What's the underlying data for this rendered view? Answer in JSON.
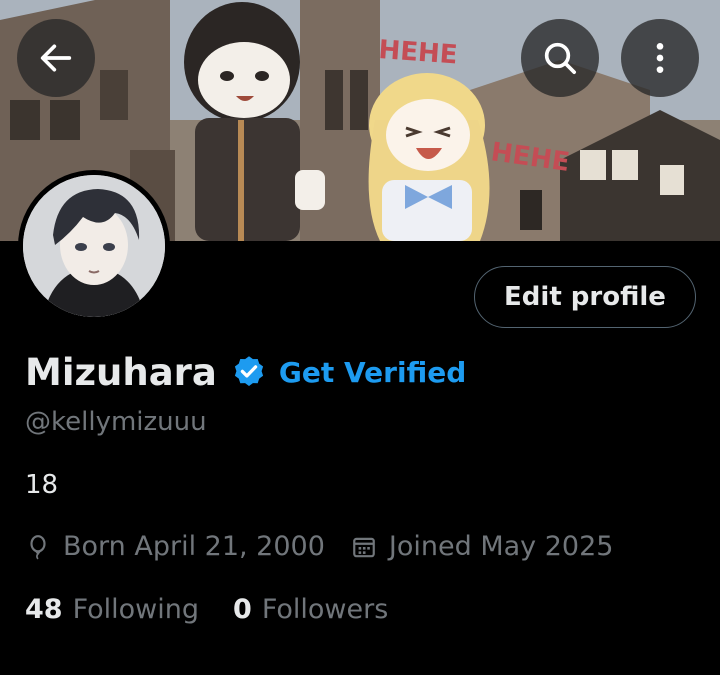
{
  "header": {
    "back_icon": "arrow-left-icon",
    "search_icon": "search-icon",
    "more_icon": "more-vertical-icon"
  },
  "banner": {
    "caption_1": "HEHE",
    "caption_2": "HEHE"
  },
  "profile": {
    "display_name": "Mizuhara",
    "verified_icon": "verified-badge-icon",
    "get_verified_label": "Get Verified",
    "handle": "@kellymizuuu",
    "bio": "18",
    "birth": "Born April 21, 2000",
    "joined": "Joined May 2025",
    "edit_label": "Edit profile"
  },
  "stats": {
    "following_count": "48",
    "following_label": "Following",
    "followers_count": "0",
    "followers_label": "Followers"
  },
  "colors": {
    "background": "#000000",
    "accent": "#1d9bf0",
    "text_primary": "#e7e9ea",
    "text_secondary": "#71767b",
    "border": "#536471"
  }
}
